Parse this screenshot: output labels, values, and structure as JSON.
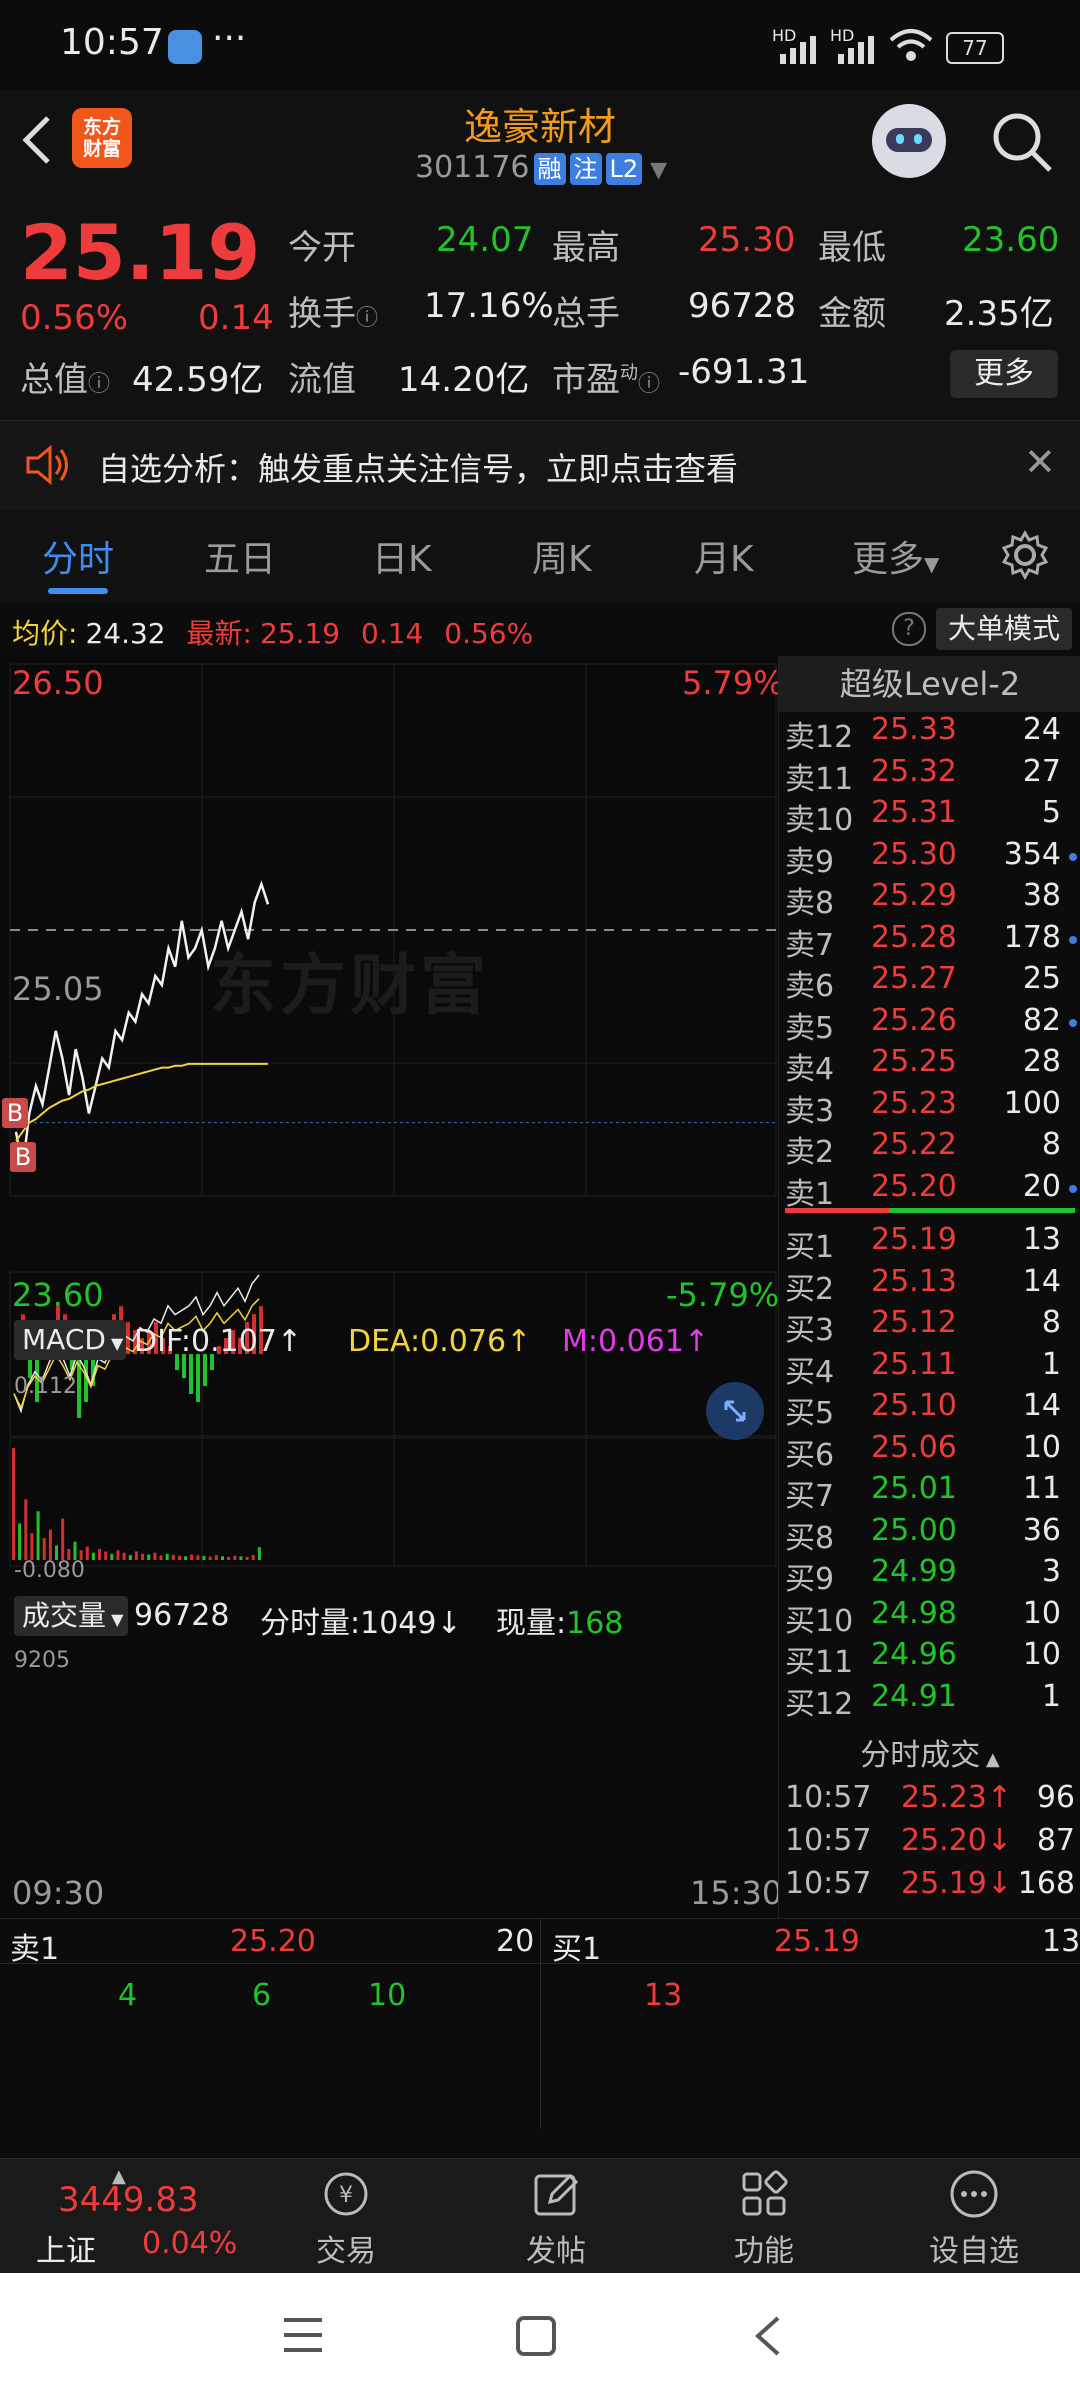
{
  "status_bar": {
    "time": "10:57",
    "net1": "HD",
    "net2": "HD",
    "battery": "77"
  },
  "header": {
    "title": "逸豪新材",
    "code": "301176",
    "tags": [
      "融",
      "注",
      "L2"
    ],
    "logo_text": "东方\n财富"
  },
  "quote": {
    "price": "25.19",
    "change_pct": "0.56%",
    "change": "0.14",
    "open_label": "今开",
    "open": "24.07",
    "high_label": "最高",
    "high": "25.30",
    "low_label": "最低",
    "low": "23.60",
    "turnover_label": "换手",
    "turnover": "17.16%",
    "volume_label": "总手",
    "volume": "96728",
    "amount_label": "金额",
    "amount": "2.35亿",
    "mktcap_label": "总值",
    "mktcap": "42.59亿",
    "float_label": "流值",
    "float": "14.20亿",
    "pe_label": "市盈",
    "pe_super": "动",
    "pe": "-691.31",
    "more_button": "更多"
  },
  "banner": {
    "text": "自选分析：触发重点关注信号，立即点击查看"
  },
  "tabs": [
    "分时",
    "五日",
    "日K",
    "周K",
    "月K",
    "更多"
  ],
  "infoline": {
    "avg_label": "均价:",
    "avg": "24.32",
    "latest_label": "最新:",
    "latest": "25.19",
    "chg": "0.14",
    "pct": "0.56%",
    "big_order_button": "大单模式"
  },
  "chart_data": {
    "type": "line",
    "price_axis": {
      "top": "26.50",
      "mid": "25.05",
      "bottom": "23.60",
      "top_pct": "5.79%",
      "bottom_pct": "-5.79%"
    },
    "price": [
      23.95,
      23.75,
      24.05,
      24.2,
      24.1,
      24.3,
      24.5,
      24.35,
      24.15,
      24.4,
      24.25,
      24.05,
      24.2,
      24.35,
      24.3,
      24.5,
      24.45,
      24.6,
      24.55,
      24.7,
      24.65,
      24.8,
      24.75,
      24.95,
      24.85,
      25.1,
      24.9,
      24.95,
      25.05,
      24.85,
      24.95,
      25.1,
      24.95,
      25.05,
      25.15,
      25.0,
      25.2,
      25.3,
      25.19
    ],
    "avg": [
      23.9,
      23.95,
      24.0,
      24.02,
      24.05,
      24.08,
      24.1,
      24.12,
      24.13,
      24.15,
      24.17,
      24.18,
      24.2,
      24.21,
      24.22,
      24.23,
      24.24,
      24.25,
      24.26,
      24.27,
      24.28,
      24.29,
      24.3,
      24.3,
      24.31,
      24.31,
      24.32,
      24.32,
      24.32,
      24.32,
      24.32,
      24.32,
      24.32,
      24.32,
      24.32,
      24.32,
      24.32,
      24.32,
      24.32
    ],
    "ylim": [
      23.6,
      26.5
    ],
    "buy_markers": [
      "B",
      "B"
    ],
    "watermark": "东方财富",
    "macd": {
      "label": "MACD",
      "dif_label": "DIF:",
      "dif": "0.107",
      "dea_label": "DEA:",
      "dea": "0.076",
      "m_label": "M:",
      "m": "0.061",
      "top": "0.112",
      "bottom": "-0.080",
      "hist": [
        0.03,
        0.05,
        -0.03,
        -0.06,
        0.02,
        0.04,
        0.06,
        0.05,
        -0.02,
        -0.08,
        -0.06,
        -0.04,
        0.02,
        0.03,
        0.05,
        0.06,
        0.04,
        0.03,
        0.02,
        0.03,
        0.04,
        0.02,
        0.01,
        -0.02,
        -0.03,
        -0.05,
        -0.06,
        -0.04,
        -0.02,
        0.01,
        0.02,
        0.03,
        0.02,
        0.04,
        0.05,
        0.06
      ]
    },
    "volume": {
      "label": "成交量",
      "total": "96728",
      "minute_label": "分时量:",
      "minute": "1049",
      "now_label": "现量:",
      "now": "168",
      "top": "9205",
      "bars": [
        9205,
        3000,
        5000,
        2200,
        4000,
        1800,
        2500,
        1200,
        3400,
        900,
        1500,
        800,
        1100,
        600,
        900,
        700,
        500,
        800,
        600,
        400,
        700,
        500,
        450,
        600,
        380,
        500,
        420,
        350,
        300,
        450,
        380,
        320,
        280,
        400,
        300,
        250,
        350,
        300,
        260,
        400,
        1049
      ]
    },
    "time_start": "09:30",
    "time_end": "15:30"
  },
  "orderbook": {
    "header": "超级Level-2",
    "asks": [
      {
        "label": "卖12",
        "price": "25.33",
        "vol": "24"
      },
      {
        "label": "卖11",
        "price": "25.32",
        "vol": "27"
      },
      {
        "label": "卖10",
        "price": "25.31",
        "vol": "5"
      },
      {
        "label": "卖9",
        "price": "25.30",
        "vol": "354"
      },
      {
        "label": "卖8",
        "price": "25.29",
        "vol": "38"
      },
      {
        "label": "卖7",
        "price": "25.28",
        "vol": "178"
      },
      {
        "label": "卖6",
        "price": "25.27",
        "vol": "25"
      },
      {
        "label": "卖5",
        "price": "25.26",
        "vol": "82"
      },
      {
        "label": "卖4",
        "price": "25.25",
        "vol": "28"
      },
      {
        "label": "卖3",
        "price": "25.23",
        "vol": "100"
      },
      {
        "label": "卖2",
        "price": "25.22",
        "vol": "8"
      },
      {
        "label": "卖1",
        "price": "25.20",
        "vol": "20"
      }
    ],
    "bids": [
      {
        "label": "买1",
        "price": "25.19",
        "vol": "13"
      },
      {
        "label": "买2",
        "price": "25.13",
        "vol": "14"
      },
      {
        "label": "买3",
        "price": "25.12",
        "vol": "8"
      },
      {
        "label": "买4",
        "price": "25.11",
        "vol": "1"
      },
      {
        "label": "买5",
        "price": "25.10",
        "vol": "14"
      },
      {
        "label": "买6",
        "price": "25.06",
        "vol": "10"
      },
      {
        "label": "买7",
        "price": "25.01",
        "vol": "11"
      },
      {
        "label": "买8",
        "price": "25.00",
        "vol": "36"
      },
      {
        "label": "买9",
        "price": "24.99",
        "vol": "3"
      },
      {
        "label": "买10",
        "price": "24.98",
        "vol": "10"
      },
      {
        "label": "买11",
        "price": "24.96",
        "vol": "10"
      },
      {
        "label": "买12",
        "price": "24.91",
        "vol": "1"
      }
    ],
    "ticks_header": "分时成交",
    "ticks": [
      {
        "time": "10:57",
        "price": "25.23↑",
        "vol": "96",
        "dir": "up"
      },
      {
        "time": "10:57",
        "price": "25.20↓",
        "vol": "87",
        "dir": "down"
      },
      {
        "time": "10:57",
        "price": "25.19↓",
        "vol": "168",
        "dir": "up"
      }
    ]
  },
  "mini_panel": {
    "sell_label": "卖1",
    "sell_price": "25.20",
    "sell_vol": "20",
    "buy_label": "买1",
    "buy_price": "25.19",
    "buy_vol": "13",
    "sell_queue": [
      "4",
      "6",
      "10"
    ],
    "buy_queue": [
      "13"
    ]
  },
  "bottom_nav": {
    "index_name": "上证",
    "index_value": "3449.83",
    "index_pct": "0.04%",
    "items": [
      "交易",
      "发帖",
      "功能",
      "设自选"
    ]
  }
}
